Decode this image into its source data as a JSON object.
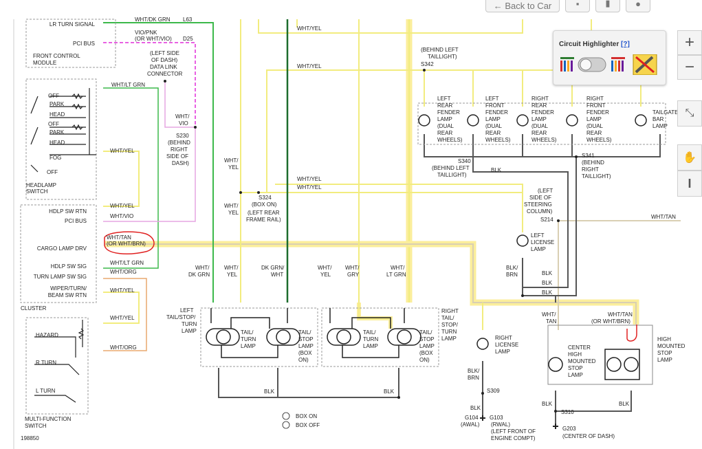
{
  "toolbar": {
    "back_label": "Back to Car",
    "icons": [
      "back-arrow-icon",
      "print-icon",
      "bookmark-icon",
      "info-icon"
    ]
  },
  "highlighter": {
    "title": "Circuit Highlighter",
    "help": "[?]",
    "state": "off"
  },
  "zoom": {
    "in": "+",
    "out": "−",
    "cursor": "I"
  },
  "colors": {
    "green": "#3cb84a",
    "dark_green": "#1b6b2c",
    "magenta": "#e02bd8",
    "pink": "#e6a5e2",
    "yellow": "#f2ec7e",
    "highlight": "#fbee9b",
    "tan": "#d9cfb3",
    "dark": "#555555",
    "orange": "#e9a86f",
    "annotation_red": "#e02020"
  },
  "labels": {
    "lr_turn_signal": "LR TURN SIGNAL",
    "pci_bus": "PCI BUS",
    "front_control_module": [
      "FRONT CONTROL",
      "MODULE"
    ],
    "wht_dk_grn": "WHT/DK GRN",
    "l63": "L63",
    "vio_pnk": [
      "VIO/PNK",
      "(OR WHT/VIO)"
    ],
    "d25": "D25",
    "data_link": [
      "(LEFT SIDE",
      "OF DASH)",
      "DATA LINK",
      "CONNECTOR"
    ],
    "wht_vio": [
      "WHT/",
      "VIO"
    ],
    "s230": [
      "S230",
      "(BEHIND",
      "RIGHT",
      "SIDE OF",
      "DASH)"
    ],
    "wht_lt_grn": "WHT/LT GRN",
    "wht_yel": "WHT/YEL",
    "wht_vio_h": "WHT/VIO",
    "wht_org": "WHT/ORG",
    "switch_off": "OFF",
    "park": "PARK",
    "head": "HEAD",
    "fog": "FOG",
    "headlamp_switch": [
      "HEADLAMP",
      "SWITCH"
    ],
    "hdlp_sw_rtn": "HDLP SW RTN",
    "cargo_lamp_drv": "CARGO LAMP DRV",
    "hdlp_sw_sig": "HDLP SW SIG",
    "turn_lamp_sw_sig": "TURN LAMP SW SIG",
    "wiper_beam": [
      "WIPER/TURN/",
      "BEAM SW RTN"
    ],
    "cluster": "CLUSTER",
    "wht_tan_or": [
      "WHT/TAN",
      "(OR WHT/BRN)"
    ],
    "hazard": "HAZARD",
    "r_turn": "R TURN",
    "l_turn": "L TURN",
    "multi_function_switch": [
      "MULTI-FUNCTION",
      "SWITCH"
    ],
    "figure_id": "198850",
    "s324": [
      "S324",
      "(BOX ON)",
      "(LEFT REAR",
      "FRAME RAIL)"
    ],
    "wht_yel_stack": [
      "WHT/",
      "YEL"
    ],
    "wht_dk_grn_stack": [
      "WHT/",
      "DK GRN"
    ],
    "dk_grn_wht": [
      "DK GRN/",
      "WHT"
    ],
    "wht_grn_stack": [
      "WHT/",
      "GRY"
    ],
    "wht_lt_grn_stack": [
      "WHT/",
      "LT GRN"
    ],
    "left_tail_stop_turn": [
      "LEFT",
      "TAIL/STOP/",
      "TURN",
      "LAMP"
    ],
    "tail_turn_lamp": [
      "TAIL/",
      "TURN",
      "LAMP"
    ],
    "tail_stop_lamp_box": [
      "TAIL/",
      "STOP",
      "LAMP",
      "(BOX",
      "ON)"
    ],
    "right_tail_stop_turn": [
      "RIGHT",
      "TAIL/",
      "STOP/",
      "TURN",
      "LAMP"
    ],
    "blk": "BLK",
    "blk_brn": [
      "BLK/",
      "BRN"
    ],
    "box_on": "BOX ON",
    "box_off": "BOX OFF",
    "s342": [
      "(BEHIND LEFT",
      "TAILLIGHT)",
      "S342"
    ],
    "lr_fender": [
      "LEFT",
      "REAR",
      "FENDER",
      "LAMP",
      "(DUAL",
      "REAR",
      "WHEELS)"
    ],
    "lf_fender": [
      "LEFT",
      "FRONT",
      "FENDER",
      "LAMP",
      "(DUAL",
      "REAR",
      "WHEELS)"
    ],
    "rr_fender": [
      "RIGHT",
      "REAR",
      "FENDER",
      "LAMP",
      "(DUAL",
      "REAR",
      "WHEELS)"
    ],
    "rf_fender": [
      "RIGHT",
      "FRONT",
      "FENDER",
      "LAMP",
      "(DUAL",
      "REAR",
      "WHEELS)"
    ],
    "tailgate": [
      "TAILGATE",
      "BAR",
      "LAMP"
    ],
    "s340": [
      "S340",
      "(BEHIND LEFT",
      "TAILLIGHT)"
    ],
    "s341": [
      "S341",
      "(BEHIND",
      "RIGHT",
      "TAILLIGHT)"
    ],
    "s214": [
      "(LEFT",
      "SIDE OF",
      "STEERING",
      "COLUMN)",
      "S214"
    ],
    "wht_tan": "WHT/TAN",
    "left_license": [
      "LEFT",
      "LICENSE",
      "LAMP"
    ],
    "right_license": [
      "RIGHT",
      "LICENSE",
      "LAMP"
    ],
    "s309": "S309",
    "g104": [
      "G104",
      "(AWAL)"
    ],
    "g103": [
      "G103",
      "(RWAL)",
      "(LEFT FRONT OF",
      "ENGINE COMPT)"
    ],
    "center_high": [
      "CENTER",
      "HIGH",
      "MOUNTED",
      "STOP",
      "LAMP"
    ],
    "high_mounted": [
      "HIGH",
      "MOUNTED",
      "STOP",
      "LAMP"
    ],
    "wht_tan_stack": [
      "WHT/",
      "TAN"
    ],
    "wht_tan_or_brn": [
      "WHT/TAN",
      "(OR WHT/BRN)"
    ],
    "s310": "S310",
    "g203": [
      "G203",
      "(CENTER OF DASH)"
    ]
  }
}
